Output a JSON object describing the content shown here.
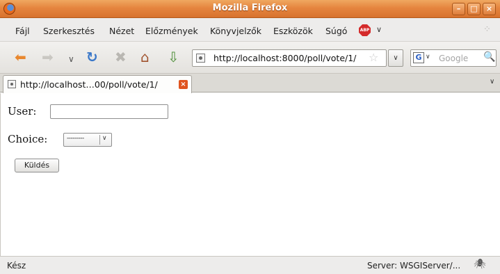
{
  "window": {
    "title": "Mozilla Firefox",
    "controls": {
      "minimize": "–",
      "maximize": "□",
      "close": "×"
    }
  },
  "menubar": {
    "items": [
      "Fájl",
      "Szerkesztés",
      "Nézet",
      "Előzmények",
      "Könyvjelzők",
      "Eszközök",
      "Súgó"
    ],
    "adblock_label": "ABP",
    "adblock_menu": "∨"
  },
  "toolbar": {
    "back": "⬅",
    "forward": "➡",
    "history_dropdown": "∨",
    "reload": "↻",
    "stop": "✖",
    "home": "⌂",
    "download": "⇩",
    "url": "http://localhost:8000/poll/vote/1/",
    "bookmark_star": "☆",
    "url_dropdown": "∨",
    "search_engine": "G",
    "search_engine_dropdown": "∨",
    "search_placeholder": "Google",
    "search_button": "🔍"
  },
  "tabs": {
    "items": [
      {
        "label": "http://localhost…00/poll/vote/1/",
        "close": "×"
      }
    ],
    "list_all": "∨"
  },
  "form": {
    "user_label": "User:",
    "user_value": "",
    "choice_label": "Choice:",
    "choice_selected": "---------",
    "choice_arrow": "∨",
    "submit_label": "Küldés"
  },
  "status": {
    "text": "Kész",
    "server": "Server: WSGIServer/...",
    "bug_icon": "🕷"
  },
  "colors": {
    "titlebar_accent": "#e5853f",
    "menubar_bg": "#edeceb",
    "back_arrow": "#e8872e",
    "reload": "#3b78c9"
  },
  "icons": [
    "firefox-logo-icon",
    "back-arrow-icon",
    "forward-arrow-icon",
    "reload-icon",
    "stop-icon",
    "home-icon",
    "download-icon",
    "page-favicon-icon",
    "star-icon",
    "google-icon",
    "search-icon",
    "tab-close-icon",
    "adblock-icon",
    "throbber-icon",
    "bug-icon"
  ]
}
